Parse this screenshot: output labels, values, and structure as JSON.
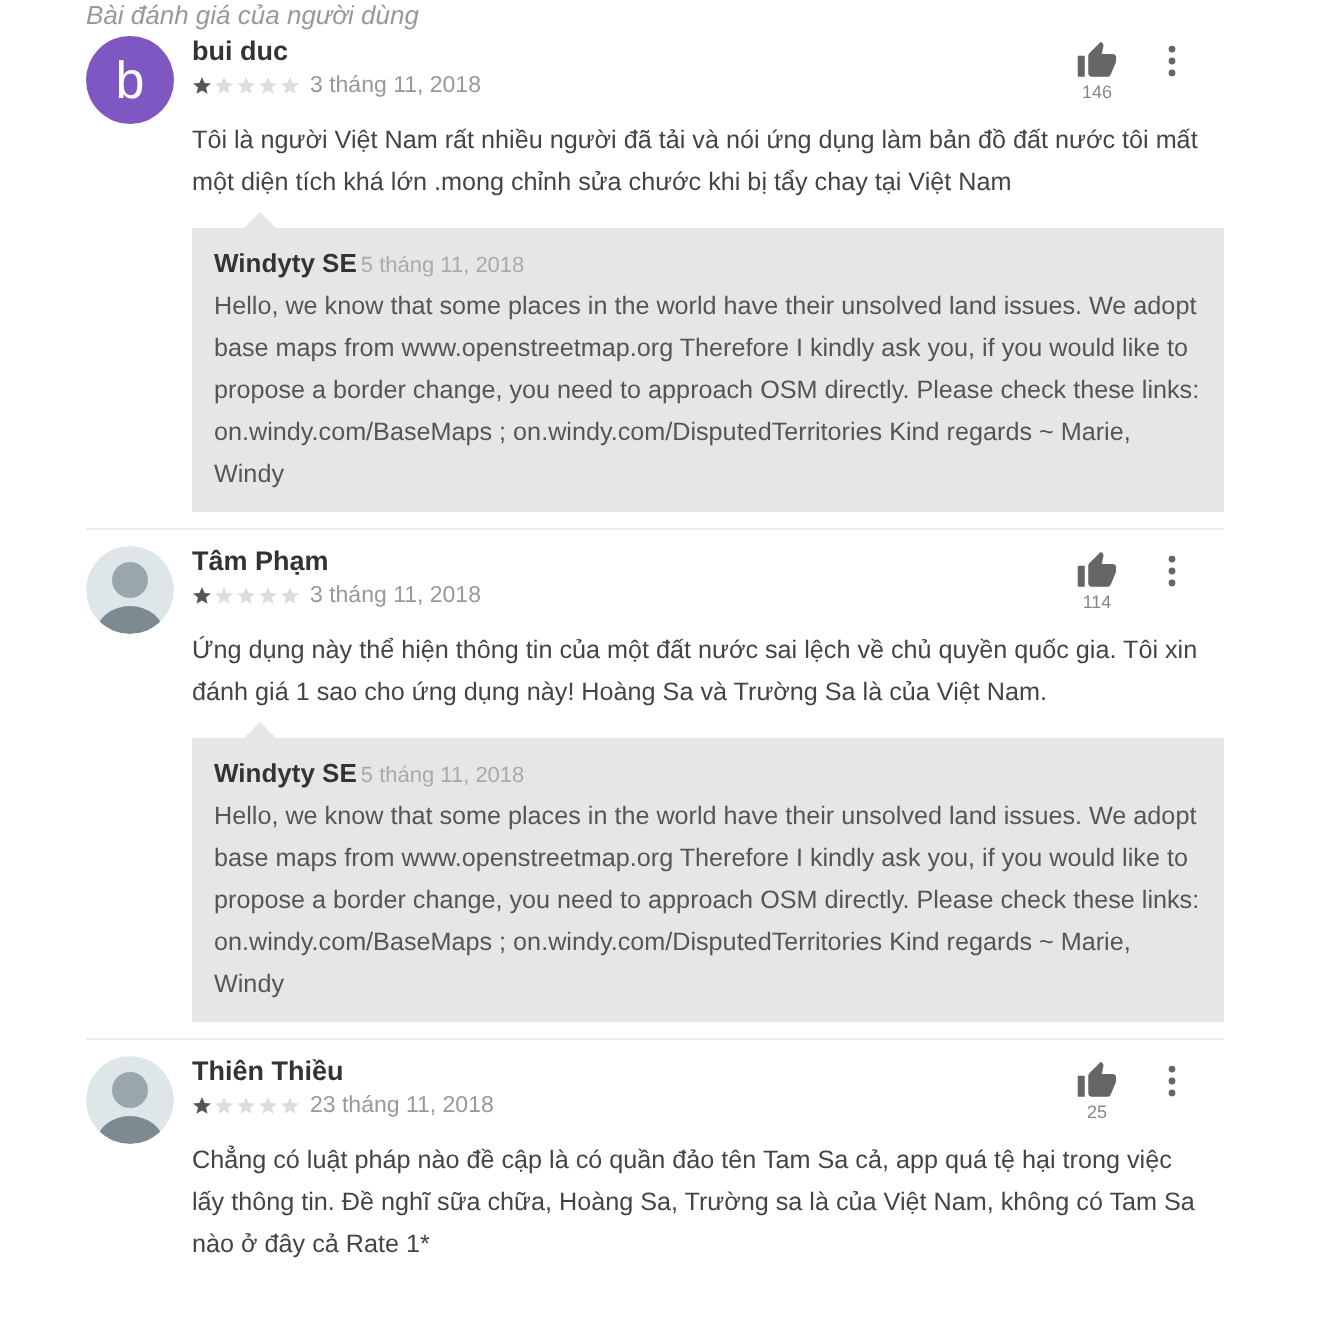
{
  "section_title": "Bài đánh giá của người dùng",
  "reviews": [
    {
      "author": "bui duc",
      "avatar": {
        "kind": "letter",
        "letter": "b",
        "color": "#7e57c2"
      },
      "stars": 1,
      "date": "3 tháng 11, 2018",
      "likes": "146",
      "text": "Tôi là người Việt Nam rất nhiều người đã tải và nói ứng dụng làm bản đồ đất nước tôi mất một diện tích khá lớn .mong chỉnh sửa chước khi bị tẩy chay tại Việt Nam",
      "reply": {
        "author": "Windyty SE",
        "date": "5 tháng 11, 2018",
        "text": "Hello, we know that some places in the world have their unsolved land issues. We adopt base maps from www.openstreetmap.org Therefore I kindly ask you, if you would like to propose a border change, you need to approach OSM directly. Please check these links: on.windy.com/BaseMaps ; on.windy.com/DisputedTerritories Kind regards ~ Marie, Windy"
      }
    },
    {
      "author": "Tâm Phạm",
      "stars": 1,
      "date": "3 tháng 11, 2018",
      "likes": "114",
      "text": "Ứng dụng này thể hiện thông tin của một đất nước sai lệch về chủ quyền quốc gia. Tôi xin đánh giá 1 sao cho ứng dụng này! Hoàng Sa và Trường Sa là của Việt Nam.",
      "reply": {
        "author": "Windyty SE",
        "date": "5 tháng 11, 2018",
        "text": "Hello, we know that some places in the world have their unsolved land issues. We adopt base maps from www.openstreetmap.org Therefore I kindly ask you, if you would like to propose a border change, you need to approach OSM directly. Please check these links: on.windy.com/BaseMaps ; on.windy.com/DisputedTerritories Kind regards ~ Marie, Windy"
      }
    },
    {
      "author": "Thiên Thiều",
      "stars": 1,
      "date": "23 tháng 11, 2018",
      "likes": "25",
      "text": "Chẳng có luật pháp nào đề cập là có quần đảo tên Tam Sa cả, app quá tệ hại trong việc lấy thông tin. Đề nghĩ sữa chữa, Hoàng Sa, Trường sa là của Việt Nam, không có Tam Sa nào ở đây cả Rate 1*"
    }
  ]
}
